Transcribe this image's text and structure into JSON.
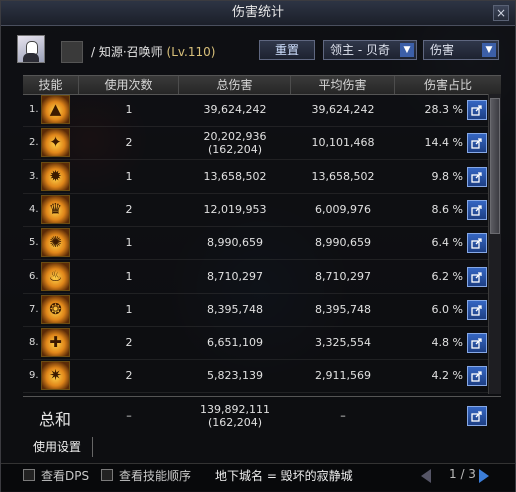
{
  "window": {
    "title": "伤害统计",
    "close_label": "×"
  },
  "character": {
    "name": "/ 知源·召唤师",
    "level": "(Lv.110)"
  },
  "controls": {
    "reset_label": "重置",
    "boss_filter": "领主 - 贝奇",
    "metric_filter": "伤害",
    "dropdown_arrow": "▼"
  },
  "table": {
    "headers": [
      "技能",
      "使用次数",
      "总伤害",
      "平均伤害",
      "伤害占比"
    ],
    "rows": [
      {
        "rank": "1.",
        "icon": "flame-burst-icon",
        "glyph": "▲",
        "uses": "1",
        "total": "39,624,242",
        "total_sub": "",
        "avg": "39,624,242",
        "pct": "28.3 %"
      },
      {
        "rank": "2.",
        "icon": "golden-slash-icon",
        "glyph": "✦",
        "uses": "2",
        "total": "20,202,936",
        "total_sub": "(162,204)",
        "avg": "10,101,468",
        "pct": "14.4 %"
      },
      {
        "rank": "3.",
        "icon": "beast-summon-icon",
        "glyph": "✹",
        "uses": "1",
        "total": "13,658,502",
        "total_sub": "",
        "avg": "13,658,502",
        "pct": "9.8 %"
      },
      {
        "rank": "4.",
        "icon": "crown-spirit-icon",
        "glyph": "♛",
        "uses": "2",
        "total": "12,019,953",
        "total_sub": "",
        "avg": "6,009,976",
        "pct": "8.6 %"
      },
      {
        "rank": "5.",
        "icon": "sun-sigil-icon",
        "glyph": "✺",
        "uses": "1",
        "total": "8,990,659",
        "total_sub": "",
        "avg": "8,990,659",
        "pct": "6.4 %"
      },
      {
        "rank": "6.",
        "icon": "fire-demon-icon",
        "glyph": "♨",
        "uses": "1",
        "total": "8,710,297",
        "total_sub": "",
        "avg": "8,710,297",
        "pct": "6.2 %"
      },
      {
        "rank": "7.",
        "icon": "phoenix-wing-icon",
        "glyph": "❂",
        "uses": "1",
        "total": "8,395,748",
        "total_sub": "",
        "avg": "8,395,748",
        "pct": "6.0 %"
      },
      {
        "rank": "8.",
        "icon": "cross-rune-icon",
        "glyph": "✚",
        "uses": "2",
        "total": "6,651,109",
        "total_sub": "",
        "avg": "3,325,554",
        "pct": "4.8 %"
      },
      {
        "rank": "9.",
        "icon": "spiral-orb-icon",
        "glyph": "✷",
        "uses": "2",
        "total": "5,823,139",
        "total_sub": "",
        "avg": "2,911,569",
        "pct": "4.2 %"
      }
    ]
  },
  "total": {
    "label": "总和",
    "uses": "–",
    "total": "139,892,111",
    "total_sub": "(162,204)",
    "avg": "–"
  },
  "settings": {
    "label": "使用设置"
  },
  "footer": {
    "show_dps": "查看DPS",
    "show_order": "查看技能顺序",
    "dungeon": "地下城名 = 毁坏的寂静城",
    "page": "1 / 3"
  },
  "colors": {
    "accent": "#3b7dd8",
    "share_button": "#2a55a8",
    "icon_gold": "#e0861a"
  }
}
